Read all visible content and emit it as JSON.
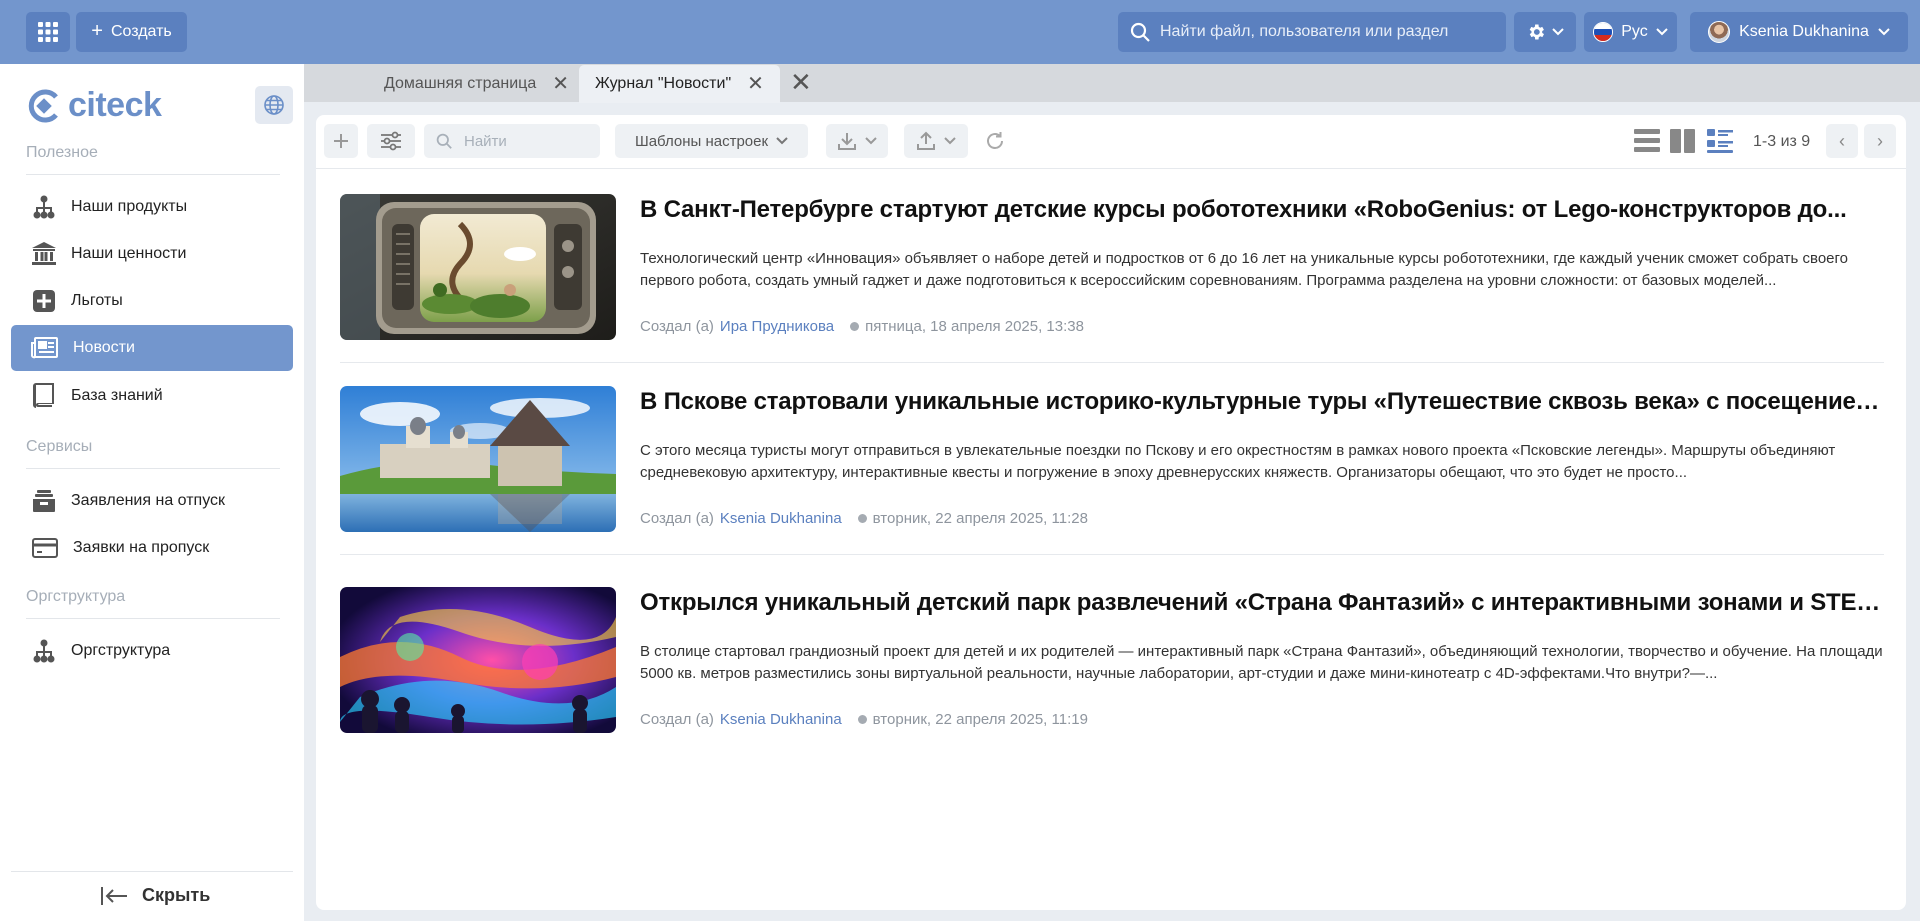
{
  "topbar": {
    "create_label": "Создать",
    "search_placeholder": "Найти файл, пользователя или раздел",
    "language": "Рус",
    "user_name": "Ksenia Dukhanina"
  },
  "sidebar": {
    "logo_text": "citeck",
    "sections": [
      {
        "title": "Полезное",
        "items": [
          "Наши продукты",
          "Наши ценности",
          "Льготы",
          "Новости",
          "База знаний"
        ]
      },
      {
        "title": "Сервисы",
        "items": [
          "Заявления на отпуск",
          "Заявки на пропуск"
        ]
      },
      {
        "title": "Оргструктура",
        "items": [
          "Оргструктура"
        ]
      }
    ],
    "active_item": "Новости",
    "hide_label": "Скрыть"
  },
  "tabs": [
    {
      "label": "Домашняя страница",
      "active": false
    },
    {
      "label": "Журнал \"Новости\"",
      "active": true
    }
  ],
  "toolbar": {
    "search_placeholder": "Найти",
    "templates_label": "Шаблоны настроек",
    "counter": "1-3 из 9"
  },
  "news": [
    {
      "title": "В Санкт-Петербурге стартуют детские курсы робототехники «RoboGenius: от Lego-конструкторов до...",
      "text": "Технологический центр «Инновация» объявляет о наборе детей и подростков от 6 до 16 лет на уникальные курсы робототехники, где каждый ученик сможет собрать своего первого робота, создать умный гаджет и даже подготовиться к всероссийским соревнованиям. Программа разделена на уровни сложности: от базовых моделей...",
      "created_prefix": "Создал (а)",
      "author": "Ира Прудникова",
      "date": "пятница, 18 апреля 2025, 13:38"
    },
    {
      "title": "В Пскове стартовали уникальные историко-культурные туры «Путешествие сквозь века» с посещением...",
      "text": "С этого месяца туристы могут отправиться в увлекательные поездки по Пскову и его окрестностям в рамках нового проекта «Псковские легенды». Маршруты объединяют средневековую архитектуру, интерактивные квесты и погружение в эпоху древнерусских княжеств. Организаторы обещают, что это будет не просто...",
      "created_prefix": "Создал (а)",
      "author": "Ksenia Dukhanina",
      "date": "вторник, 22 апреля 2025, 11:28"
    },
    {
      "title": "Открылся уникальный детский парк развлечений «Страна Фантазий» с интерактивными зонами и STEM-...",
      "text": "В столице стартовал грандиозный проект для детей и их родителей — интерактивный парк «Страна Фантазий», объединяющий технологии, творчество и обучение. На площади 5000 кв. метров разместились зоны виртуальной реальности, научные лаборатории, арт-студии и даже мини-кинотеатр с 4D-эффектами.Что внутри?—...",
      "created_prefix": "Создал (а)",
      "author": "Ksenia Dukhanina",
      "date": "вторник, 22 апреля 2025, 11:19"
    }
  ],
  "colors": {
    "brand": "#7396cd",
    "brand_dark": "#5b80bf",
    "link": "#5b80bf"
  }
}
